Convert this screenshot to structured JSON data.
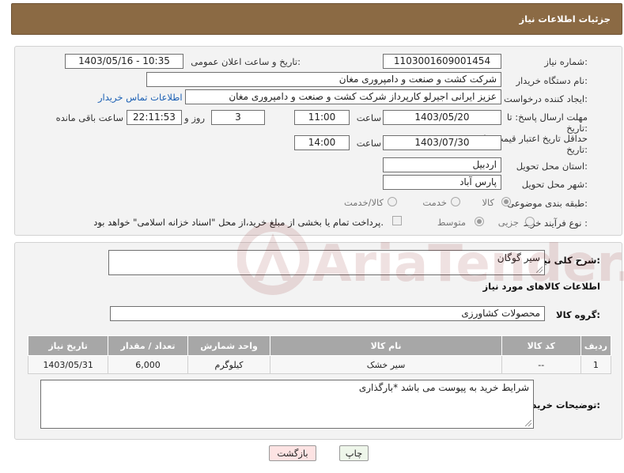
{
  "header": {
    "title": "جزئیات اطلاعات نیاز"
  },
  "form": {
    "need_number_label": "شماره نیاز:",
    "need_number": "1103001609001454",
    "announce_label": "تاریخ و ساعت اعلان عمومی:",
    "announce_value": "1403/05/16 - 10:35",
    "buyer_org_label": "نام دستگاه خریدار:",
    "buyer_org": "شرکت کشت و صنعت و دامپروری مغان",
    "creator_label": "ایجاد کننده درخواست:",
    "creator": "عزیز ایرانی اجیرلو کارپرداز شرکت کشت و صنعت و دامپروری مغان",
    "contact_link": "اطلاعات تماس خریدار",
    "deadline_label_1": "مهلت ارسال پاسخ: تا",
    "deadline_label_2": "تاریخ:",
    "deadline_date": "1403/05/20",
    "time_label": "ساعت",
    "deadline_time": "11:00",
    "days_value": "3",
    "days_label": "روز و",
    "remaining_time": "22:11:53",
    "remaining_label": "ساعت باقی مانده",
    "validity_label_1": "حداقل تاریخ اعتبار قیمت: تا",
    "validity_label_2": "تاریخ:",
    "validity_date": "1403/07/30",
    "validity_time": "14:00",
    "province_label": "استان محل تحویل:",
    "province": "اردبیل",
    "city_label": "شهر محل تحویل:",
    "city": "پارس آباد",
    "category_label": "طبقه بندی موضوعی:",
    "category_options": [
      "کالا",
      "خدمت",
      "کالا/خدمت"
    ],
    "process_label": "نوع فرآیند خرید :",
    "process_options": [
      "جزیی",
      "متوسط"
    ],
    "payment_note": "پرداخت تمام یا بخشی از مبلغ خرید،از محل \"اسناد خزانه اسلامی\" خواهد بود."
  },
  "details": {
    "description_label": "شرح کلی نیاز:",
    "description": "سیر گوگان",
    "goods_info_title": "اطلاعات کالاهای مورد نیاز",
    "group_label": "گروه کالا:",
    "group_value": "محصولات کشاورزی",
    "table": {
      "headers": [
        "ردیف",
        "کد کالا",
        "نام کالا",
        "واحد شمارش",
        "تعداد / مقدار",
        "تاریخ نیاز"
      ],
      "rows": [
        [
          "1",
          "--",
          "سیر خشک",
          "کیلوگرم",
          "6,000",
          "1403/05/31"
        ]
      ]
    },
    "buyer_notes_label": "توضیحات خریدار:",
    "buyer_notes": "شرایط خرید به پیوست می باشد *بارگذاری"
  },
  "buttons": {
    "print": "چاپ",
    "back": "بازگشت"
  },
  "watermark": {
    "text": "AriaTender.net"
  },
  "colors": {
    "header": "#8b6a44",
    "back_button": "#fde3e3",
    "print_button": "#eef6ea"
  }
}
